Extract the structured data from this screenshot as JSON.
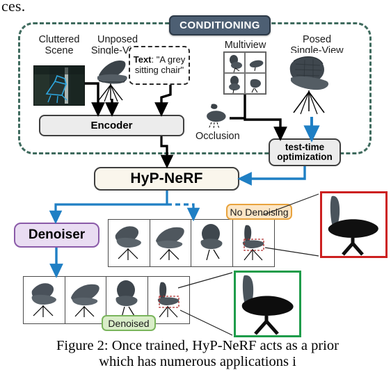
{
  "figure": {
    "top_partial_text": "ces.",
    "caption_line1": "Figure 2: Once trained, HyP-NeRF acts as a prior",
    "caption_line2": "which has numerous applications i"
  },
  "conditioning": {
    "badge_label": "CONDITIONING",
    "border_color": "#3f6b5e",
    "badge_bg": "#4d5f73",
    "inputs": [
      {
        "name": "cluttered-scene",
        "label_line1": "Cluttered",
        "label_line2": "Scene"
      },
      {
        "name": "unposed-single-view",
        "label_line1": "Unposed",
        "label_line2": "Single-View"
      },
      {
        "name": "multiview",
        "label_line1": "Multiview",
        "label_line2": ""
      },
      {
        "name": "posed-single-view",
        "label_line1": "Posed",
        "label_line2": "Single-View"
      }
    ],
    "text_prompt": {
      "key": "Text",
      "separator": ": ",
      "value": "\"A grey sitting chair\""
    },
    "occlusion_label": "Occlusion"
  },
  "blocks": {
    "encoder": {
      "label": "Encoder",
      "bg": "#ececec",
      "border": "#3f3f3f"
    },
    "test_time_optimization": {
      "line1": "test-time",
      "line2": "optimization",
      "bg": "#ececec",
      "border": "#3f3f3f"
    },
    "hyp_nerf": {
      "label": "HyP-NeRF",
      "bg": "#faf6ec",
      "border": "#3f3f3f"
    },
    "denoiser": {
      "label": "Denoiser",
      "bg": "#e9dcf2",
      "border": "#8a5aa8"
    }
  },
  "results": {
    "no_denoising": {
      "pill_label": "No Denoising",
      "pill_bg": "#fce6c6",
      "pill_border": "#e8a33d",
      "inset_border": "#cc2020",
      "renders": [
        "render-1",
        "render-2",
        "render-3",
        "render-4"
      ]
    },
    "denoised": {
      "pill_label": "Denoised",
      "pill_bg": "#d9edc8",
      "pill_border": "#7ab55c",
      "inset_border": "#1e9c4a",
      "renders": [
        "render-1",
        "render-2",
        "render-3",
        "render-4"
      ]
    }
  },
  "colors": {
    "blue_arrow": "#1f7fc4",
    "black_arrow": "#000000",
    "dashed_green": "#3f6b5e"
  }
}
